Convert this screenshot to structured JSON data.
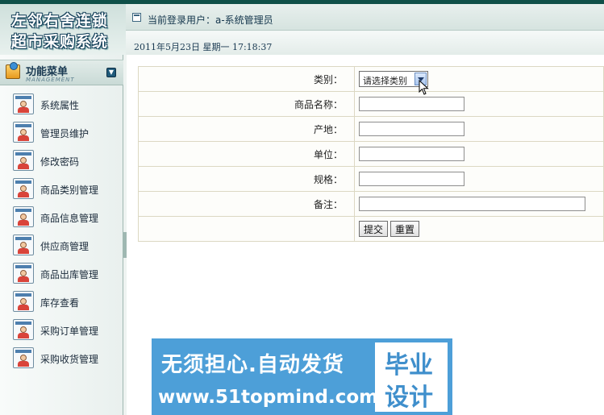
{
  "header": {
    "logo_line1": "左邻右舍连锁",
    "logo_line2": "超市采购系统",
    "current_user_label": "当前登录用户：a-系统管理员",
    "datetime": "2011年5月23日  星期一  17:18:37"
  },
  "sidebar": {
    "title": "功能菜单",
    "subtitle": "MANAGEMENT",
    "items": [
      {
        "label": "系统属性"
      },
      {
        "label": "管理员维护"
      },
      {
        "label": "修改密码"
      },
      {
        "label": "商品类别管理"
      },
      {
        "label": "商品信息管理"
      },
      {
        "label": "供应商管理"
      },
      {
        "label": "商品出库管理"
      },
      {
        "label": "库存查看"
      },
      {
        "label": "采购订单管理"
      },
      {
        "label": "采购收货管理"
      }
    ]
  },
  "form": {
    "category_label": "类别：",
    "category_selected": "请选择类别",
    "name_label": "商品名称：",
    "name_value": "",
    "origin_label": "产地：",
    "origin_value": "",
    "unit_label": "单位：",
    "unit_value": "",
    "spec_label": "规格：",
    "spec_value": "",
    "remark_label": "备注：",
    "remark_value": "",
    "submit_label": "提交",
    "reset_label": "重置"
  },
  "ad": {
    "line1": "无须担心.自动发货",
    "line2": "www.51topmind.com",
    "box_line1": "毕业",
    "box_line2": "设计"
  },
  "colors": {
    "top_strip": "#0f5049",
    "menu_icon_bar": "#4d7fae",
    "ad_blue": "#4d9fd8",
    "table_border": "#dcd8c3"
  }
}
